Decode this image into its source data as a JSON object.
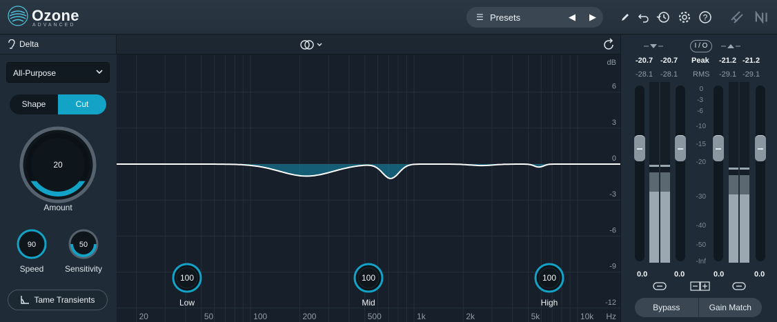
{
  "app": {
    "name": "Ozone",
    "edition": "ADVANCED"
  },
  "header": {
    "presets_label": "Presets"
  },
  "left": {
    "delta_label": "Delta",
    "mode": "All-Purpose",
    "shape_label": "Shape",
    "cut_label": "Cut",
    "amount": {
      "value": "20",
      "label": "Amount",
      "level": 0.2
    },
    "speed": {
      "value": "90",
      "label": "Speed",
      "level": 0.9
    },
    "sensitivity": {
      "value": "50",
      "label": "Sensitivity",
      "level": 0.5
    },
    "tame_label": "Tame Transients"
  },
  "graph": {
    "db_label": "dB",
    "db_ticks": [
      "6",
      "3",
      "0",
      "-3",
      "-6",
      "-9",
      "-12"
    ],
    "freq_ticks": [
      "20",
      "50",
      "100",
      "200",
      "500",
      "1k",
      "2k",
      "5k",
      "10k"
    ],
    "hz_label": "Hz",
    "bands": [
      {
        "label": "Low",
        "value": "100"
      },
      {
        "label": "Mid",
        "value": "100"
      },
      {
        "label": "High",
        "value": "100"
      }
    ]
  },
  "meters": {
    "in_peak": [
      "-20.7",
      "-20.7"
    ],
    "in_rms": [
      "-28.1",
      "-28.1"
    ],
    "out_peak": [
      "-21.2",
      "-21.2"
    ],
    "out_rms": [
      "-29.1",
      "-29.1"
    ],
    "io_label": "I / O",
    "peak_label": "Peak",
    "rms_label": "RMS",
    "scale": [
      "0",
      "-3",
      "-6",
      "-10",
      "-15",
      "-20",
      "-30",
      "-40",
      "-50",
      "-Inf"
    ],
    "bottom_values": [
      "0.0",
      "0.0",
      "0.0",
      "0.0"
    ],
    "bypass_label": "Bypass",
    "gain_match_label": "Gain Match"
  },
  "colors": {
    "accent": "#12a3c7",
    "background": "#1a2530"
  }
}
